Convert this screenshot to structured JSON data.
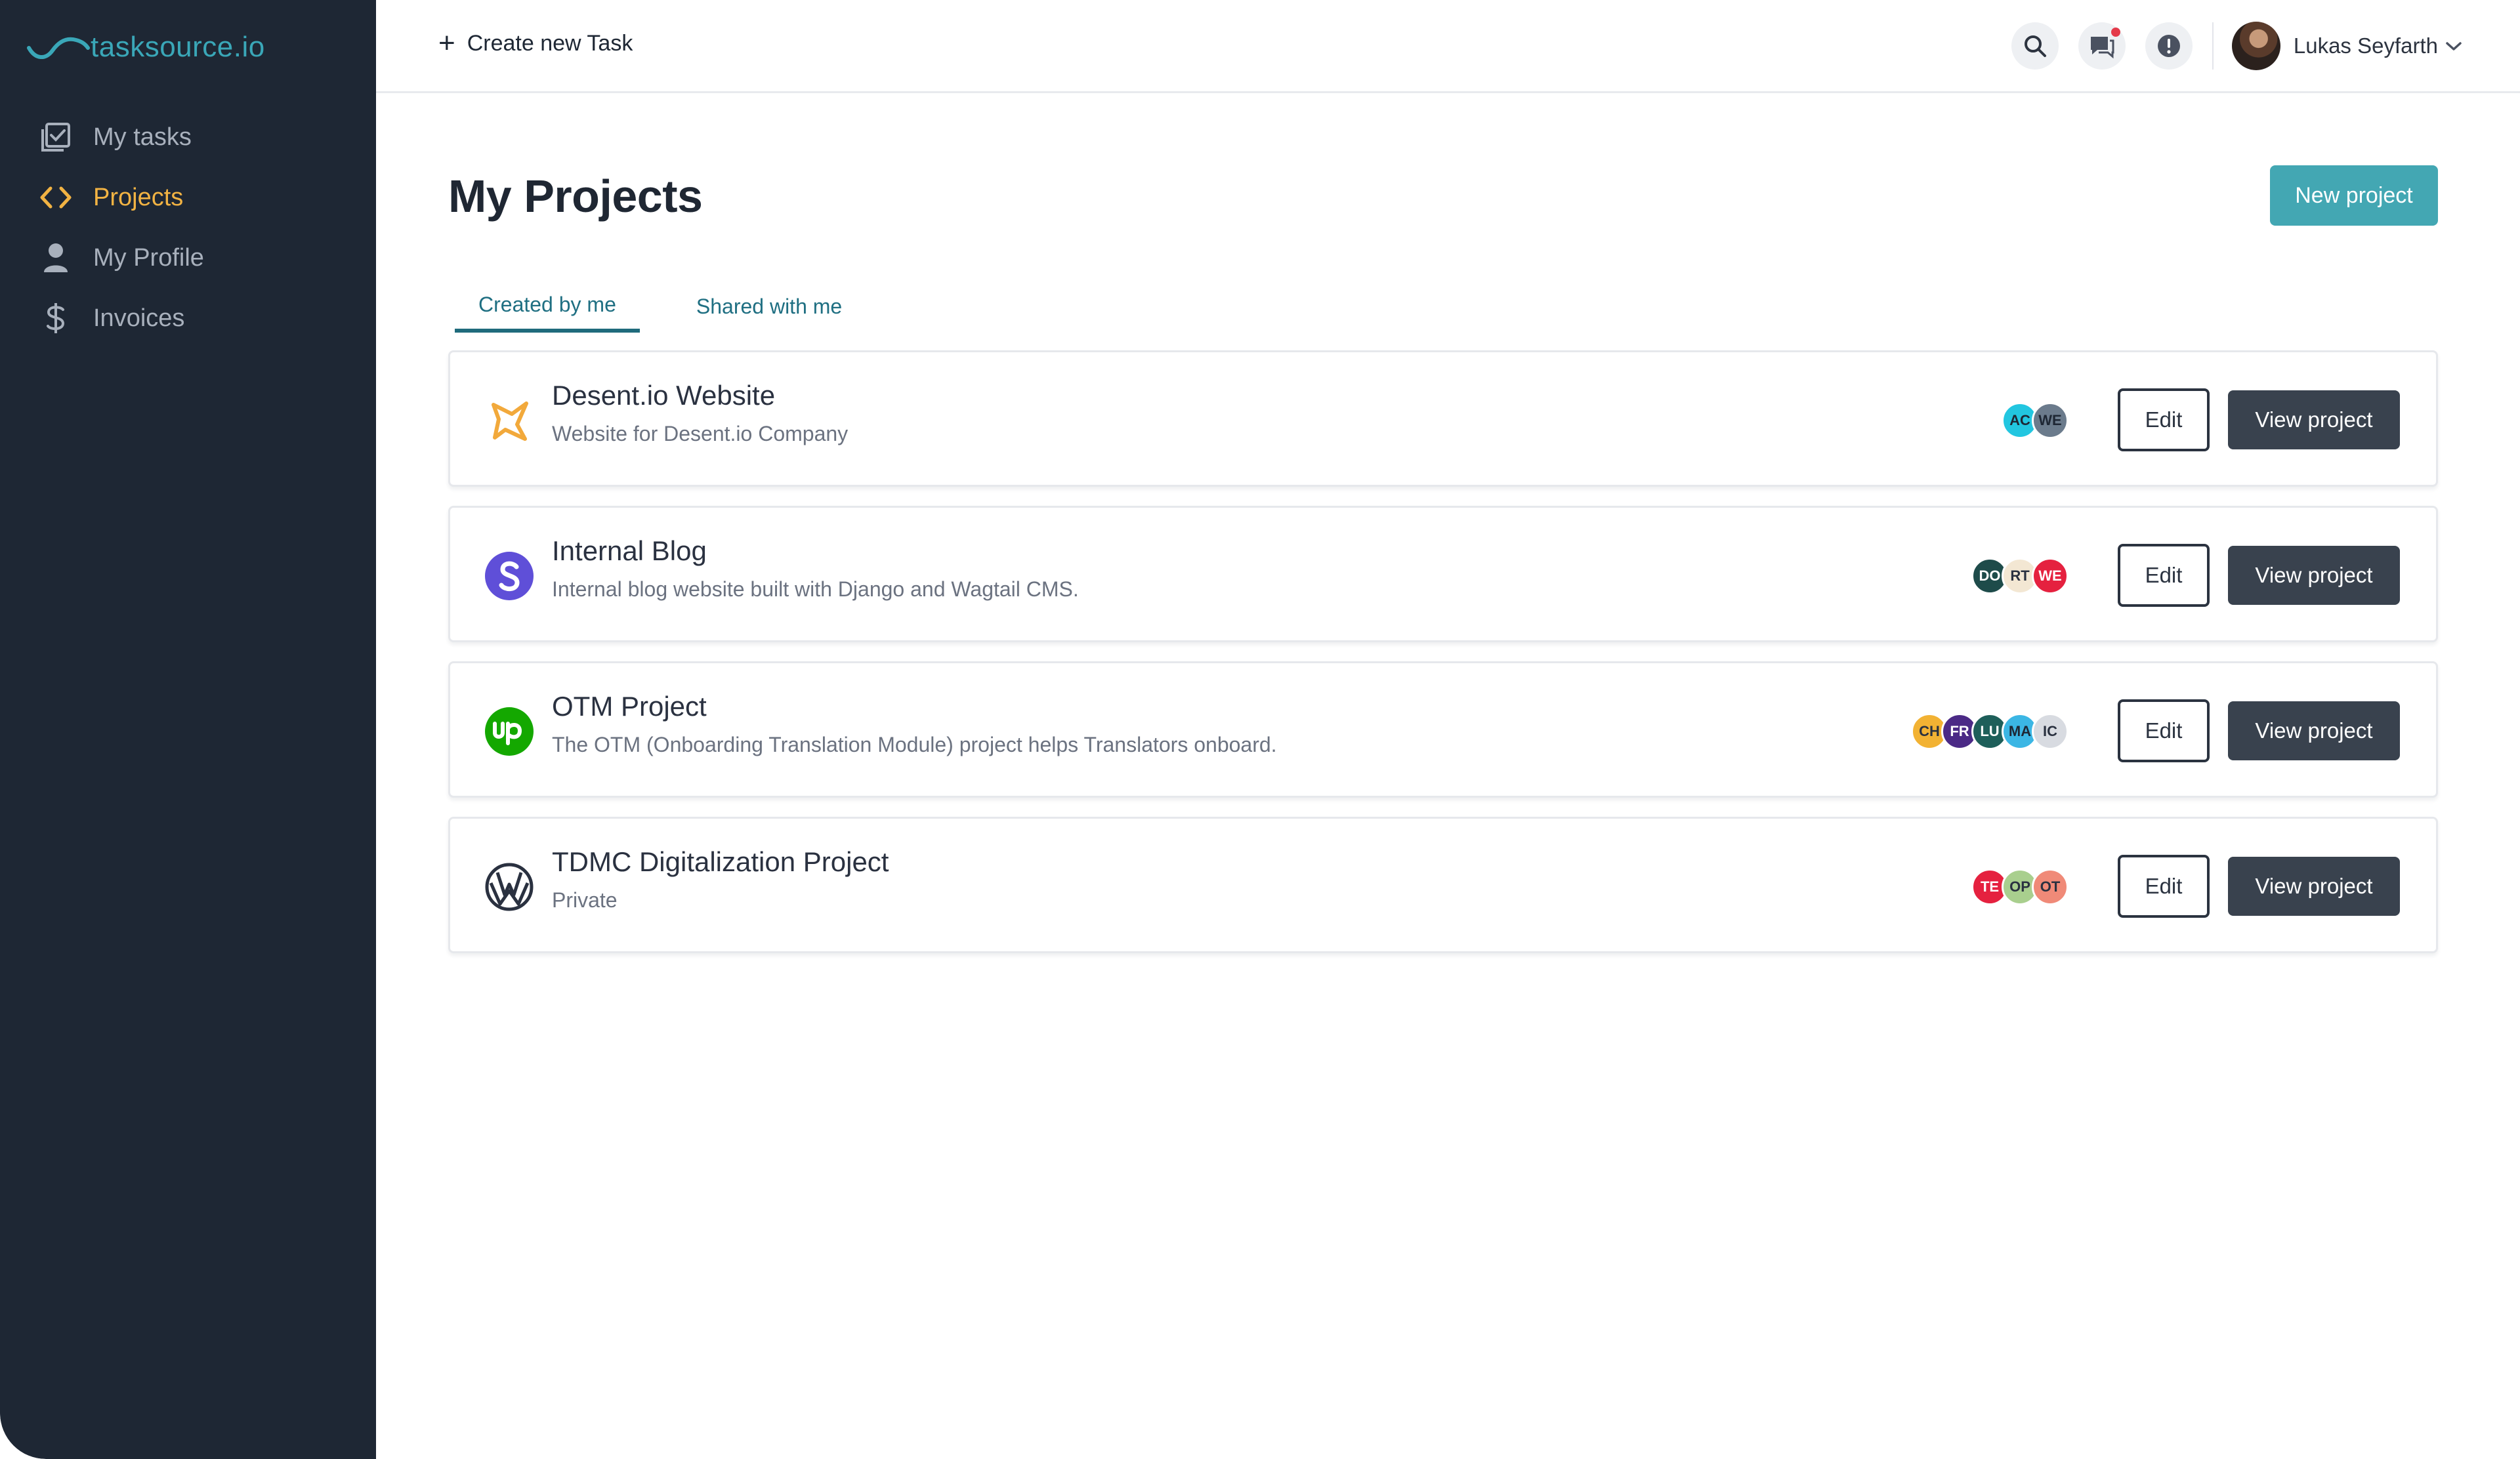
{
  "app": {
    "brand": "tasksource.io"
  },
  "sidebar": {
    "items": [
      {
        "label": "My tasks",
        "icon": "checkbox-list-icon",
        "active": false
      },
      {
        "label": "Projects",
        "icon": "code-icon",
        "active": true
      },
      {
        "label": "My Profile",
        "icon": "user-icon",
        "active": false
      },
      {
        "label": "Invoices",
        "icon": "dollar-icon",
        "active": false
      }
    ]
  },
  "topbar": {
    "create_task_label": "Create new Task",
    "user_name": "Lukas Seyfarth"
  },
  "main": {
    "title": "My Projects",
    "new_project_label": "New project",
    "tabs": [
      {
        "label": "Created by me",
        "active": true
      },
      {
        "label": "Shared with me",
        "active": false
      }
    ],
    "edit_label": "Edit",
    "view_label": "View project",
    "projects": [
      {
        "title": "Desent.io Website",
        "description": "Website for Desent.io Company",
        "members": [
          {
            "initials": "AC",
            "color": "#22c6e0"
          },
          {
            "initials": "WE",
            "color": "#6b7b8c"
          }
        ]
      },
      {
        "title": "Internal Blog",
        "description": "Internal blog website built with Django and Wagtail CMS.",
        "members": [
          {
            "initials": "DO",
            "color": "#1e4b4a"
          },
          {
            "initials": "RT",
            "color": "#f3e7d3"
          },
          {
            "initials": "WE",
            "color": "#e5213f"
          }
        ]
      },
      {
        "title": "OTM Project",
        "description": "The OTM (Onboarding Translation Module) project helps Translators onboard.",
        "members": [
          {
            "initials": "CH",
            "color": "#f2b233"
          },
          {
            "initials": "FR",
            "color": "#4b2a86"
          },
          {
            "initials": "LU",
            "color": "#1e5f5a"
          },
          {
            "initials": "MA",
            "color": "#3bb6e4"
          },
          {
            "initials": "IC",
            "color": "#d8dbe1"
          }
        ]
      },
      {
        "title": "TDMC Digitalization Project",
        "description": "Private",
        "members": [
          {
            "initials": "TE",
            "color": "#e5213f"
          },
          {
            "initials": "OP",
            "color": "#a9cf8e"
          },
          {
            "initials": "OT",
            "color": "#f08a78"
          }
        ]
      }
    ]
  },
  "colors": {
    "sidebar_bg": "#1e2734",
    "accent_teal": "#43a7b3",
    "active_nav": "#f2b343",
    "dark_button": "#39424e"
  }
}
